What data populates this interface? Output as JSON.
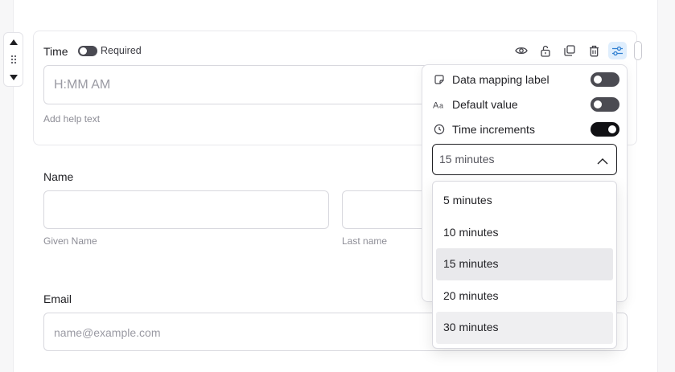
{
  "time_field": {
    "label": "Time",
    "required_label": "Required",
    "placeholder": "H:MM AM",
    "help_text": "Add help text"
  },
  "toolbar": {
    "icons": [
      "eye-icon",
      "unlock-icon",
      "duplicate-icon",
      "trash-icon",
      "settings-sliders-icon"
    ],
    "active_icon": "settings-sliders-icon"
  },
  "name_field": {
    "label": "Name",
    "given_helper": "Given Name",
    "last_helper": "Last name"
  },
  "email_field": {
    "label": "Email",
    "placeholder": "name@example.com"
  },
  "settings_panel": {
    "options": [
      {
        "label": "Data mapping label",
        "icon": "tag-icon",
        "enabled": false
      },
      {
        "label": "Default value",
        "icon": "text-aa-icon",
        "enabled": false
      },
      {
        "label": "Time increments",
        "icon": "clock-icon",
        "enabled": true
      }
    ],
    "increment_select": {
      "selected": "15 minutes",
      "options": [
        "5 minutes",
        "10 minutes",
        "15 minutes",
        "20 minutes",
        "30 minutes"
      ]
    }
  },
  "colors": {
    "accent_active_bg": "#dfeefd",
    "accent_icon": "#2f7fd1",
    "switch_on": "#111114",
    "switch_off": "#4b4b52"
  }
}
